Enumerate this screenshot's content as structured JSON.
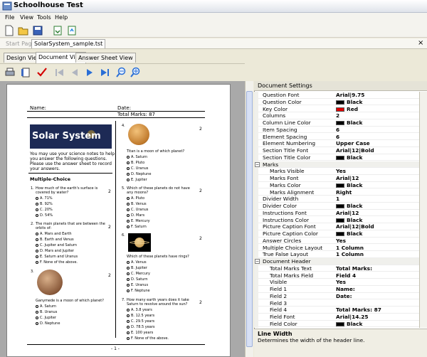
{
  "window": {
    "title": "Schoolhouse Test"
  },
  "menu": [
    "File",
    "View",
    "Tools",
    "Help"
  ],
  "tabs": {
    "start": "Start Page",
    "file": "SolarSystem_sample.tst",
    "close": "×"
  },
  "view_tabs": [
    "Design View",
    "Document View",
    "Answer Sheet View"
  ],
  "icons": {
    "toolbar": [
      "new-document-icon",
      "open-folder-icon",
      "save-icon",
      "print-preview-icon",
      "export-icon"
    ],
    "toolbar2": [
      "print-icon",
      "page-icon",
      "check-mark-icon",
      "first-page-icon",
      "previous-page-icon",
      "next-page-icon",
      "last-page-icon",
      "zoom-out-icon",
      "zoom-in-icon"
    ]
  },
  "colors": {
    "red": "#e00000",
    "black": "#000000",
    "banner_blue": "#14204a"
  },
  "document": {
    "name_label": "Name:",
    "date_label": "Date:",
    "total_marks": "Total Marks: 87",
    "banner": "Solar System",
    "instructions": [
      "You may use your science notes to help",
      "you answer the following questions.",
      "Please use the answer sheet to record",
      "your answers."
    ],
    "section": "Multiple-Choice",
    "page_number": "- 1 -",
    "left_questions": [
      {
        "n": "1.",
        "text": [
          "How much of the earth's surface is",
          "covered by water?"
        ],
        "marks": "2",
        "options": [
          "A. 71%",
          "B. 92%",
          "C. 20%",
          "D. 54%"
        ]
      },
      {
        "n": "2.",
        "text": [
          "The main planets that are between the",
          "orbits of:"
        ],
        "marks": "2",
        "options": [
          "A. Mars and Earth",
          "B. Earth and Venus",
          "C. Jupiter and Saturn",
          "D. Mars and Jupiter",
          "E. Saturn and Uranus",
          "F. None of the above."
        ]
      },
      {
        "n": "3.",
        "text": [
          "Ganymede is a moon of which planet?"
        ],
        "marks": "2",
        "options": [
          "A. Saturn",
          "B. Uranus",
          "C. Jupiter",
          "D. Neptune"
        ]
      }
    ],
    "right_questions": [
      {
        "n": "4.",
        "text": [
          "Titan is a moon of which planet?"
        ],
        "marks": "2",
        "options": [
          "A. Saturn",
          "B. Pluto",
          "C. Uranus",
          "D. Neptune",
          "E. Jupiter"
        ]
      },
      {
        "n": "5.",
        "text": [
          "Which of these planets do not have",
          "any moons?"
        ],
        "marks": "2",
        "options": [
          "A. Pluto",
          "B. Venus",
          "C. Uranus",
          "D. Mars",
          "E. Mercury",
          "F. Saturn"
        ]
      },
      {
        "n": "6.",
        "text": [
          "Which of these planets have rings?"
        ],
        "marks": "2",
        "options": [
          "A. Venus",
          "B. Jupiter",
          "C. Mercury",
          "D. Saturn",
          "E. Uranus",
          "F. Neptune"
        ]
      },
      {
        "n": "7.",
        "text": [
          "How many earth years does it take",
          "Saturn to revolve around the sun?"
        ],
        "marks": "2",
        "options": [
          "A. 3.8 years",
          "B. 12.5 years",
          "C. 29.5 years",
          "D. 78.5 years",
          "E. 100 years",
          "F. None of the above."
        ]
      }
    ]
  },
  "panel": {
    "header": "Document Settings",
    "rows": [
      {
        "name": "Question Font",
        "value": "Arial|9.75"
      },
      {
        "name": "Question Color",
        "value": "Black",
        "swatch": "black"
      },
      {
        "name": "Key Color",
        "value": "Red",
        "swatch": "red"
      },
      {
        "name": "Columns",
        "value": "2"
      },
      {
        "name": "Column Line Color",
        "value": "Black",
        "swatch": "black"
      },
      {
        "name": "Item Spacing",
        "value": "6"
      },
      {
        "name": "Element Spacing",
        "value": "6"
      },
      {
        "name": "Element Numbering",
        "value": "Upper Case"
      },
      {
        "name": "Section Title Font",
        "value": "Arial|12|Bold"
      },
      {
        "name": "Section Title Color",
        "value": "Black",
        "swatch": "black"
      },
      {
        "name": "Marks",
        "value": "",
        "category": true
      },
      {
        "name": "Marks Visible",
        "value": "Yes",
        "indent": true
      },
      {
        "name": "Marks Font",
        "value": "Arial|12",
        "indent": true
      },
      {
        "name": "Marks Color",
        "value": "Black",
        "swatch": "black",
        "indent": true
      },
      {
        "name": "Marks Alignment",
        "value": "Right",
        "indent": true
      },
      {
        "name": "Divider Width",
        "value": "1"
      },
      {
        "name": "Divider Color",
        "value": "Black",
        "swatch": "black"
      },
      {
        "name": "Instructions Font",
        "value": "Arial|12"
      },
      {
        "name": "Instructions Color",
        "value": "Black",
        "swatch": "black"
      },
      {
        "name": "Picture Caption Font",
        "value": "Arial|12|Bold"
      },
      {
        "name": "Picture Caption Color",
        "value": "Black",
        "swatch": "black"
      },
      {
        "name": "Answer Circles",
        "value": "Yes"
      },
      {
        "name": "Multiple Choice Layout",
        "value": "1 Column"
      },
      {
        "name": "True False Layout",
        "value": "1 Column"
      },
      {
        "name": "Document Header",
        "value": "",
        "category": true
      },
      {
        "name": "Total Marks Text",
        "value": "Total Marks:",
        "indent": true
      },
      {
        "name": "Total Marks Field",
        "value": "Field 4",
        "indent": true
      },
      {
        "name": "Visible",
        "value": "Yes",
        "indent": true
      },
      {
        "name": "Field 1",
        "value": "Name:",
        "indent": true
      },
      {
        "name": "Field 2",
        "value": "Date:",
        "indent": true
      },
      {
        "name": "Field 3",
        "value": "",
        "indent": true
      },
      {
        "name": "Field 4",
        "value": "Total Marks: 87",
        "indent": true
      },
      {
        "name": "Field Font",
        "value": "Arial|14.25",
        "indent": true
      },
      {
        "name": "Field Color",
        "value": "Black",
        "swatch": "black",
        "indent": true
      }
    ],
    "description_title": "Line Width",
    "description_text": "Determines the width of the header line."
  }
}
